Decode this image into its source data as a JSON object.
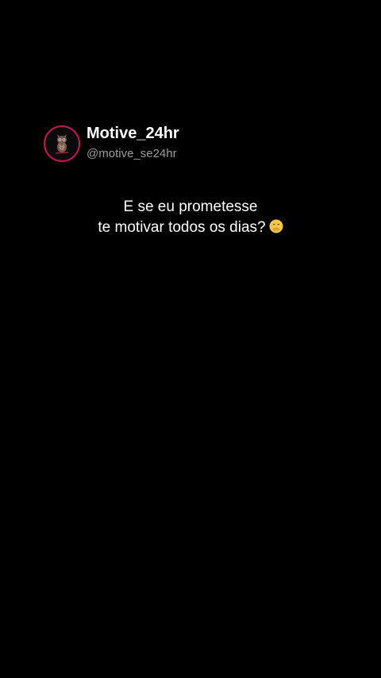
{
  "profile": {
    "display_name": "Motive_24hr",
    "handle": "@motive_se24hr",
    "avatar_icon": "owl-icon",
    "avatar_ring_color": "#c2185b"
  },
  "post": {
    "line1": "E se eu prometesse",
    "line2": "te motivar todos os dias?",
    "emoji_icon": "face-with-hand-over-mouth-emoji"
  },
  "colors": {
    "background": "#000000",
    "text": "#ffffff",
    "handle": "#9b9b9b"
  }
}
